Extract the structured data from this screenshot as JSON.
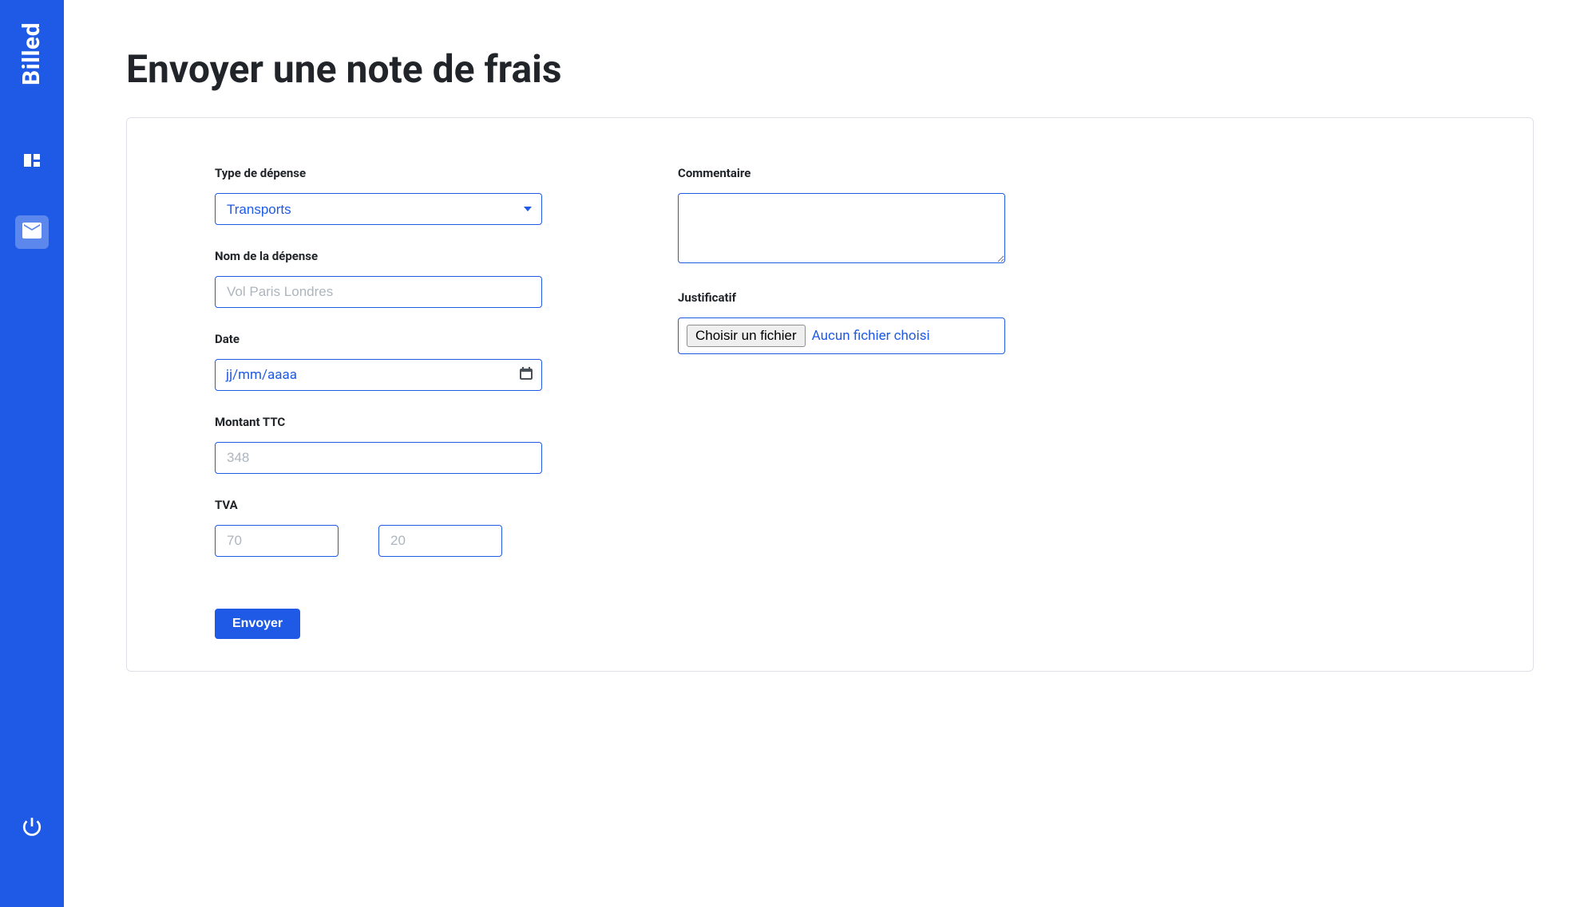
{
  "app": {
    "logo": "Billed"
  },
  "page": {
    "title": "Envoyer une note de frais"
  },
  "form": {
    "expenseType": {
      "label": "Type de dépense",
      "selected": "Transports"
    },
    "expenseName": {
      "label": "Nom de la dépense",
      "placeholder": "Vol Paris Londres"
    },
    "date": {
      "label": "Date",
      "placeholder": "jj/mm/aaaa"
    },
    "amountInclTax": {
      "label": "Montant TTC",
      "placeholder": "348"
    },
    "vat": {
      "label": "TVA",
      "amountPlaceholder": "70",
      "ratePlaceholder": "20"
    },
    "comment": {
      "label": "Commentaire"
    },
    "attachment": {
      "label": "Justificatif",
      "buttonLabel": "Choisir un fichier",
      "statusText": "Aucun fichier choisi"
    },
    "submitLabel": "Envoyer"
  }
}
